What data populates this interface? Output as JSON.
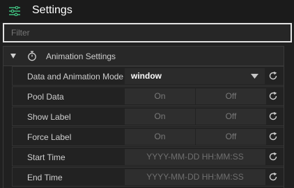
{
  "header": {
    "title": "Settings",
    "icon": "sliders-icon"
  },
  "filter": {
    "placeholder": "Filter"
  },
  "section": {
    "title": "Animation Settings",
    "icon": "stopwatch-icon",
    "expanded": true
  },
  "rows": [
    {
      "label": "Data and Animation Mode",
      "control": "select",
      "value": "window"
    },
    {
      "label": "Pool Data",
      "control": "toggle",
      "on_label": "On",
      "off_label": "Off"
    },
    {
      "label": "Show Label",
      "control": "toggle",
      "on_label": "On",
      "off_label": "Off"
    },
    {
      "label": "Force Label",
      "control": "toggle",
      "on_label": "On",
      "off_label": "Off"
    },
    {
      "label": "Start Time",
      "control": "datetime",
      "placeholder": "YYYY-MM-DD HH:MM:SS"
    },
    {
      "label": "End Time",
      "control": "datetime",
      "placeholder": "YYYY-MM-DD HH:MM:SS"
    }
  ],
  "colors": {
    "accent": "#3fbf7f",
    "background": "#202020",
    "panel": "#222222"
  }
}
